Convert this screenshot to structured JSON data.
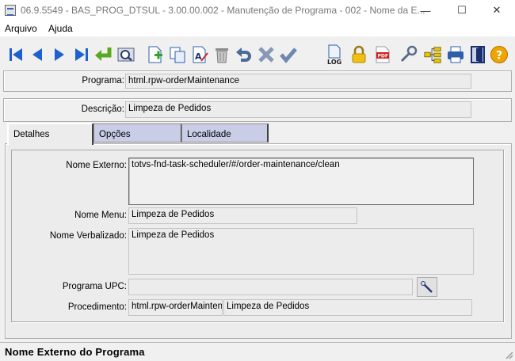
{
  "window": {
    "title": "06.9.5549 - BAS_PROG_DTSUL - 3.00.00.002 - Manutenção de Programa - 002 - Nome da E...",
    "minimize_glyph": "—",
    "maximize_glyph": "☐",
    "close_glyph": "✕"
  },
  "menu": {
    "items": [
      "Arquivo",
      "Ajuda"
    ]
  },
  "toolbar": {
    "icons": [
      "first-icon",
      "previous-icon",
      "next-icon",
      "last-icon",
      "go-to-icon",
      "search-icon",
      "add-icon",
      "copy-icon",
      "edit-icon",
      "delete-icon",
      "undo-icon",
      "cancel-icon",
      "confirm-icon",
      "log-icon",
      "lock-icon",
      "pdf-icon",
      "settings-icon",
      "hierarchy-icon",
      "print-icon",
      "exit-icon",
      "help-icon"
    ],
    "log_label": "LOG",
    "pdf_label": "PDF",
    "help_label": "?"
  },
  "header": {
    "programa_label": "Programa:",
    "programa_value": "html.rpw-orderMaintenance",
    "descricao_label": "Descrição:",
    "descricao_value": "Limpeza de Pedidos"
  },
  "tabs": [
    {
      "label": "Detalhes",
      "active": true
    },
    {
      "label": "Opções",
      "active": false
    },
    {
      "label": "Localidade",
      "active": false
    }
  ],
  "details": {
    "nome_externo_label": "Nome Externo:",
    "nome_externo_value": "totvs-fnd-task-scheduler/#/order-maintenance/clean",
    "nome_menu_label": "Nome Menu:",
    "nome_menu_value": "Limpeza de Pedidos",
    "nome_verbalizado_label": "Nome Verbalizado:",
    "nome_verbalizado_value": "Limpeza de Pedidos",
    "programa_upc_label": "Programa UPC:",
    "programa_upc_value": "",
    "procedimento_label": "Procedimento:",
    "procedimento_code": "html.rpw-orderMaintenar",
    "procedimento_desc": "Limpeza de Pedidos"
  },
  "status": {
    "text": "Nome Externo do Programa"
  },
  "colors": {
    "nav_blue": "#1f5fd1",
    "tab_inactive": "#c9cde6",
    "panel_bg": "#f0f0f0"
  }
}
